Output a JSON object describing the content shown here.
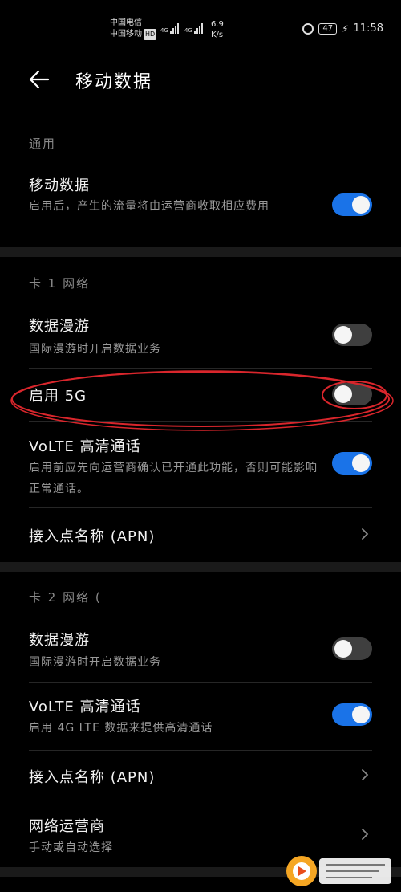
{
  "status_bar": {
    "carrier1": "中国电信",
    "carrier2": "中国移动",
    "hd_badge": "HD",
    "net1": "4G",
    "net2": "4G",
    "speed_value": "6.9",
    "speed_unit": "K/s",
    "battery": "47",
    "time": "11:58"
  },
  "header": {
    "title": "移动数据"
  },
  "general": {
    "section_label": "通用",
    "mobile_data": {
      "title": "移动数据",
      "subtitle": "启用后，产生的流量将由运营商收取相应费用",
      "enabled": true
    }
  },
  "sim1": {
    "section_label": "卡 1 网络",
    "roaming": {
      "title": "数据漫游",
      "subtitle": "国际漫游时开启数据业务",
      "enabled": false
    },
    "enable_5g": {
      "title": "启用 5G",
      "enabled": false
    },
    "volte": {
      "title": "VoLTE 高清通话",
      "subtitle": "启用前应先向运营商确认已开通此功能，否则可能影响正常通话。",
      "enabled": true
    },
    "apn": {
      "title": "接入点名称 (APN)"
    }
  },
  "sim2": {
    "section_label": "卡 2 网络 (",
    "roaming": {
      "title": "数据漫游",
      "subtitle": "国际漫游时开启数据业务",
      "enabled": false
    },
    "volte": {
      "title": "VoLTE 高清通话",
      "subtitle": "启用 4G LTE 数据来提供高清通话",
      "enabled": true
    },
    "apn": {
      "title": "接入点名称 (APN)"
    },
    "operator": {
      "title": "网络运营商",
      "subtitle": "手动或自动选择"
    }
  },
  "colors": {
    "toggle_on": "#1a73e8",
    "toggle_off": "#3f3f3f",
    "annotation": "#d9262c"
  }
}
